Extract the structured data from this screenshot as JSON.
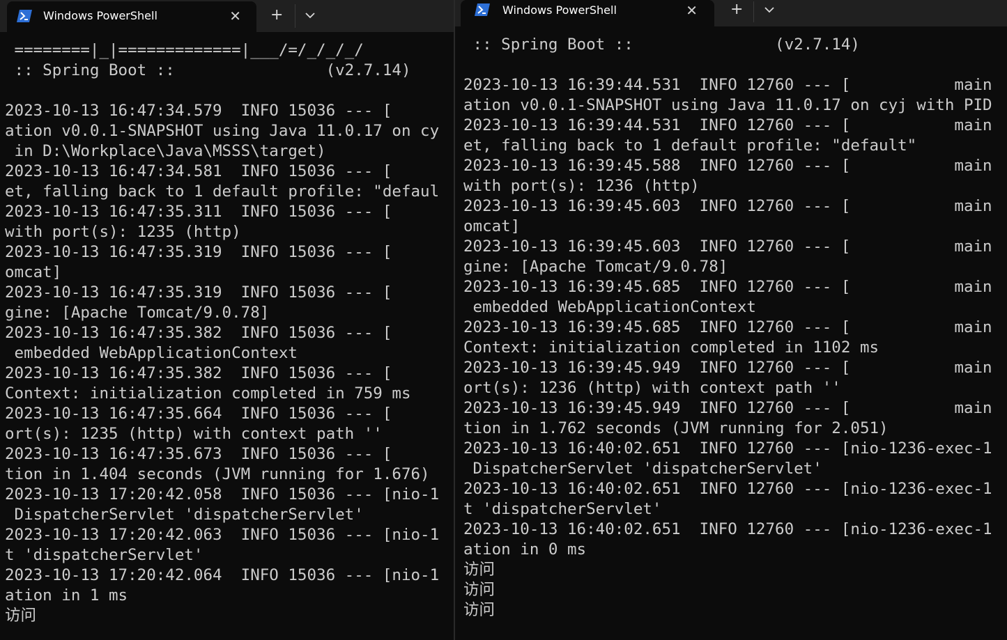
{
  "windows": [
    {
      "id": "left",
      "tab_title": "Windows PowerShell",
      "new_tab_label": "+",
      "close_label": "✕",
      "lines": [
        " ========|_|=============|___/=/_/_/_/",
        " :: Spring Boot ::                (v2.7.14)",
        "",
        "2023-10-13 16:47:34.579  INFO 15036 --- [",
        "ation v0.0.1-SNAPSHOT using Java 11.0.17 on cy",
        " in D:\\Workplace\\Java\\MSSS\\target)",
        "2023-10-13 16:47:34.581  INFO 15036 --- [",
        "et, falling back to 1 default profile: \"defaul",
        "2023-10-13 16:47:35.311  INFO 15036 --- [",
        "with port(s): 1235 (http)",
        "2023-10-13 16:47:35.319  INFO 15036 --- [",
        "omcat]",
        "2023-10-13 16:47:35.319  INFO 15036 --- [",
        "gine: [Apache Tomcat/9.0.78]",
        "2023-10-13 16:47:35.382  INFO 15036 --- [",
        " embedded WebApplicationContext",
        "2023-10-13 16:47:35.382  INFO 15036 --- [",
        "Context: initialization completed in 759 ms",
        "2023-10-13 16:47:35.664  INFO 15036 --- [",
        "ort(s): 1235 (http) with context path ''",
        "2023-10-13 16:47:35.673  INFO 15036 --- [",
        "tion in 1.404 seconds (JVM running for 1.676)",
        "2023-10-13 17:20:42.058  INFO 15036 --- [nio-1",
        " DispatcherServlet 'dispatcherServlet'",
        "2023-10-13 17:20:42.063  INFO 15036 --- [nio-1",
        "t 'dispatcherServlet'",
        "2023-10-13 17:20:42.064  INFO 15036 --- [nio-1",
        "ation in 1 ms",
        "访问"
      ]
    },
    {
      "id": "right",
      "tab_title": "Windows PowerShell",
      "new_tab_label": "+",
      "close_label": "✕",
      "lines": [
        " :: Spring Boot ::               (v2.7.14)",
        "",
        "2023-10-13 16:39:44.531  INFO 12760 --- [           main",
        "ation v0.0.1-SNAPSHOT using Java 11.0.17 on cyj with PID",
        "2023-10-13 16:39:44.531  INFO 12760 --- [           main",
        "et, falling back to 1 default profile: \"default\"",
        "2023-10-13 16:39:45.588  INFO 12760 --- [           main",
        "with port(s): 1236 (http)",
        "2023-10-13 16:39:45.603  INFO 12760 --- [           main",
        "omcat]",
        "2023-10-13 16:39:45.603  INFO 12760 --- [           main",
        "gine: [Apache Tomcat/9.0.78]",
        "2023-10-13 16:39:45.685  INFO 12760 --- [           main",
        " embedded WebApplicationContext",
        "2023-10-13 16:39:45.685  INFO 12760 --- [           main",
        "Context: initialization completed in 1102 ms",
        "2023-10-13 16:39:45.949  INFO 12760 --- [           main",
        "ort(s): 1236 (http) with context path ''",
        "2023-10-13 16:39:45.949  INFO 12760 --- [           main",
        "tion in 1.762 seconds (JVM running for 2.051)",
        "2023-10-13 16:40:02.651  INFO 12760 --- [nio-1236-exec-1",
        " DispatcherServlet 'dispatcherServlet'",
        "2023-10-13 16:40:02.651  INFO 12760 --- [nio-1236-exec-1",
        "t 'dispatcherServlet'",
        "2023-10-13 16:40:02.651  INFO 12760 --- [nio-1236-exec-1",
        "ation in 0 ms",
        "访问",
        "访问",
        "访问"
      ]
    }
  ],
  "icons": {
    "tab_icon": "powershell-icon",
    "close": "close-icon",
    "new_tab": "plus-icon",
    "dropdown": "chevron-down-icon"
  },
  "colors": {
    "terminal_bg": "#0c0c0c",
    "terminal_fg": "#cccccc",
    "tabbar_bg": "#202020",
    "powershell_blue": "#2d6fd6"
  }
}
